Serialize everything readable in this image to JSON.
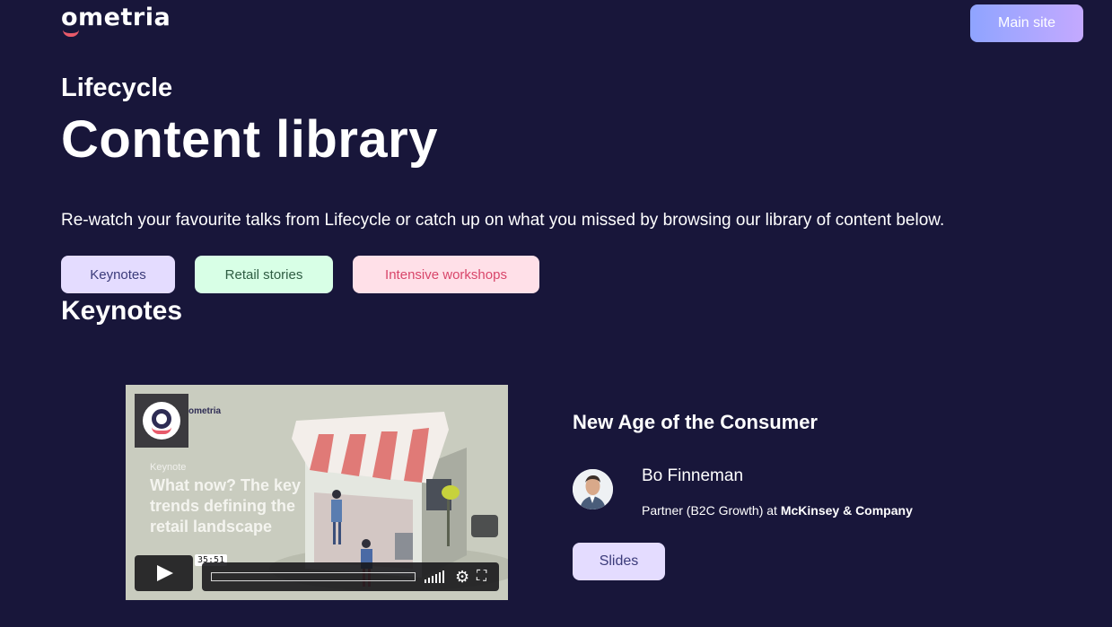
{
  "header": {
    "logo_text": "ometria",
    "main_site_label": "Main site"
  },
  "hero": {
    "eyebrow": "Lifecycle",
    "title": "Content library",
    "intro": "Re-watch your favourite talks from Lifecycle or catch up on what you missed by browsing our library of content below."
  },
  "filters": [
    {
      "label": "Keynotes"
    },
    {
      "label": "Retail stories"
    },
    {
      "label": "Intensive workshops"
    }
  ],
  "section": {
    "title": "Keynotes"
  },
  "video": {
    "brand": "ometria",
    "tag": "Keynote",
    "title": "What now? The key trends defining the retail landscape",
    "duration": "35:51"
  },
  "talk": {
    "title": "New Age of the Consumer",
    "speaker_name": "Bo Finneman",
    "speaker_role_prefix": "Partner (B2C Growth) at ",
    "speaker_company": "McKinsey & Company",
    "slides_label": "Slides"
  },
  "colors": {
    "background": "#18163a",
    "keynotes_chip": "#e4dcff",
    "retail_chip": "#d8ffe6",
    "workshops_chip": "#ffe0e8",
    "accent_pink": "#e85a6a"
  }
}
